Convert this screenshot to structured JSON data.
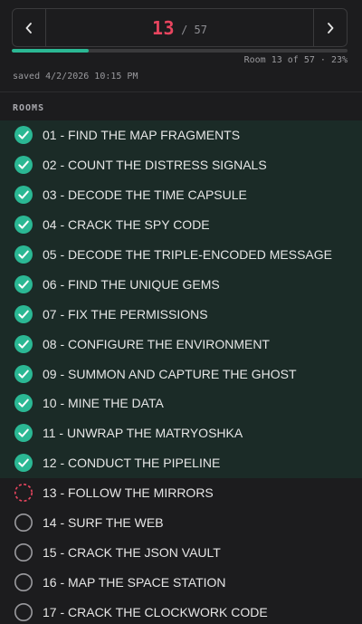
{
  "nav": {
    "current": "13",
    "total": "/ 57"
  },
  "progress": {
    "percent": 23,
    "status_text": "Room 13 of 57 · 23%"
  },
  "saved_text": "saved 4/2/2026 10:15 PM",
  "section_label": "ROOMS",
  "colors": {
    "accent_green": "#2bb894",
    "current_red": "#e8455f",
    "done_row_bg": "#1b2b27"
  },
  "rooms": [
    {
      "label": "01 - FIND THE MAP FRAGMENTS",
      "status": "done"
    },
    {
      "label": "02 - COUNT THE DISTRESS SIGNALS",
      "status": "done"
    },
    {
      "label": "03 - DECODE THE TIME CAPSULE",
      "status": "done"
    },
    {
      "label": "04 - CRACK THE SPY CODE",
      "status": "done"
    },
    {
      "label": "05 - DECODE THE TRIPLE-ENCODED MESSAGE",
      "status": "done"
    },
    {
      "label": "06 - FIND THE UNIQUE GEMS",
      "status": "done"
    },
    {
      "label": "07 - FIX THE PERMISSIONS",
      "status": "done"
    },
    {
      "label": "08 - CONFIGURE THE ENVIRONMENT",
      "status": "done"
    },
    {
      "label": "09 - SUMMON AND CAPTURE THE GHOST",
      "status": "done"
    },
    {
      "label": "10 - MINE THE DATA",
      "status": "done"
    },
    {
      "label": "11 - UNWRAP THE MATRYOSHKA",
      "status": "done"
    },
    {
      "label": "12 - CONDUCT THE PIPELINE",
      "status": "done"
    },
    {
      "label": "13 - FOLLOW THE MIRRORS",
      "status": "current"
    },
    {
      "label": "14 - SURF THE WEB",
      "status": "todo"
    },
    {
      "label": "15 - CRACK THE JSON VAULT",
      "status": "todo"
    },
    {
      "label": "16 - MAP THE SPACE STATION",
      "status": "todo"
    },
    {
      "label": "17 - CRACK THE CLOCKWORK CODE",
      "status": "todo"
    }
  ]
}
